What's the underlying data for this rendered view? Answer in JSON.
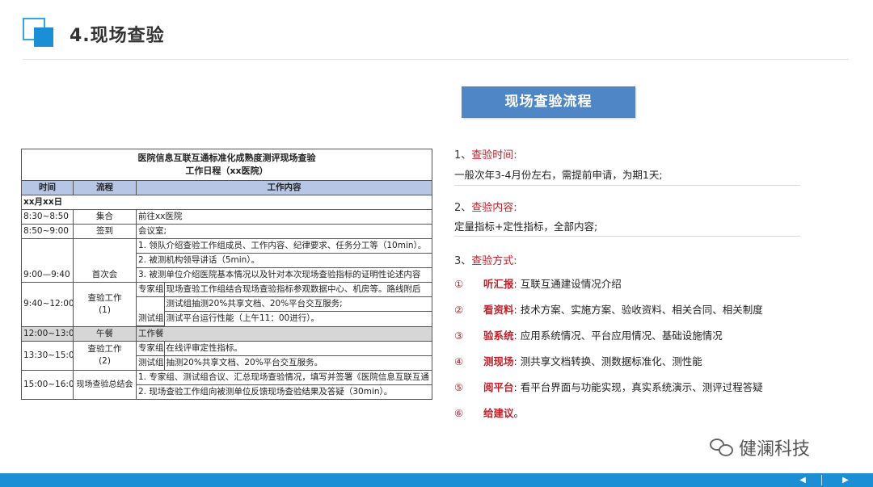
{
  "slide": {
    "title": "4.现场查验"
  },
  "schedule": {
    "title_line1": "医院信息互联互通标准化成熟度测评现场查验",
    "title_line2": "工作日程（xx医院）",
    "headers": [
      "时间",
      "流程",
      "工作内容"
    ],
    "date": "xx月xx日",
    "rows": {
      "r1": {
        "time": "8:30~8:50",
        "process": "集合",
        "content": "前往xx医院"
      },
      "r2": {
        "time": "8:50~9:00",
        "process": "签到",
        "content": "会议室;"
      },
      "r3": {
        "time": "9:00—9:40",
        "process": "首次会",
        "items": [
          "1. 领队介绍查验工作组成员、工作内容、纪律要求、任务分工等（10min）。",
          "2. 被测机构领导讲话（5min）。",
          "3. 被测单位介绍医院基本情况以及针对本次现场查验指标的证明性论述内容"
        ]
      },
      "r4": {
        "time": "9:40~12:00",
        "process_line1": "查验工作",
        "process_line2": "(1)",
        "group1": "专家组",
        "group1_content": "现场查验工作组结合现场查验指标参观数据中心、机房等。路线附后",
        "group2": "测试组",
        "group2_content1": "测试组抽测20%共享文档、20%平台交互服务;",
        "group2_content2": "测试平台运行性能（上午11：00进行）。"
      },
      "r5": {
        "time": "12:00~13:00",
        "process": "午餐",
        "content": "工作餐"
      },
      "r6": {
        "time": "13:30~15:00",
        "process_line1": "查验工作",
        "process_line2": "(2)",
        "group1": "专家组",
        "group1_content": "在线评审定性指标。",
        "group2": "测试组",
        "group2_content": "抽测20%共享文档、20%平台交互服务。"
      },
      "r7": {
        "time": "15:00~16:00",
        "process": "现场查验总结会",
        "items": [
          "1. 专家组、测试组合议、汇总现场查验情况，填写并签署《医院信息互联互通",
          "2. 现场查验工作组向被测单位反馈现场查验结果及答疑（30min）。"
        ]
      }
    }
  },
  "flow": {
    "box_label": "现场查验流程",
    "sections": [
      {
        "num": "1、",
        "title": "查验时间:",
        "body": "一般次年3-4月份左右，需提前申请，为期1天;"
      },
      {
        "num": "2、",
        "title": "查验内容:",
        "body": "定量指标+定性指标，全部内容;"
      },
      {
        "num": "3、",
        "title": "查验方式:"
      }
    ],
    "methods": [
      {
        "mark": "①",
        "key": "听汇报",
        "text": ": 互联互通建设情况介绍"
      },
      {
        "mark": "②",
        "key": "看资料",
        "text": ": 技术方案、实施方案、验收资料、相关合同、相关制度"
      },
      {
        "mark": "③",
        "key": "验系统",
        "text": ": 应用系统情况、平台应用情况、基础设施情况"
      },
      {
        "mark": "④",
        "key": "测现场",
        "text": ": 测共享文档转换、测数据标准化、测性能"
      },
      {
        "mark": "⑤",
        "key": "阅平台",
        "text": ": 看平台界面与功能实现，真实系统演示、测评过程答疑"
      },
      {
        "mark": "⑥",
        "key": "给建议",
        "text": "。"
      }
    ]
  },
  "watermark": {
    "text": "健澜科技"
  },
  "nav": {
    "prev": "◀",
    "next": "▶"
  },
  "colors": {
    "accent": "#1a8fd6",
    "flow_box": "#4f86c6",
    "highlight_red": "#c0202a",
    "table_header": "#b7c6e4"
  }
}
